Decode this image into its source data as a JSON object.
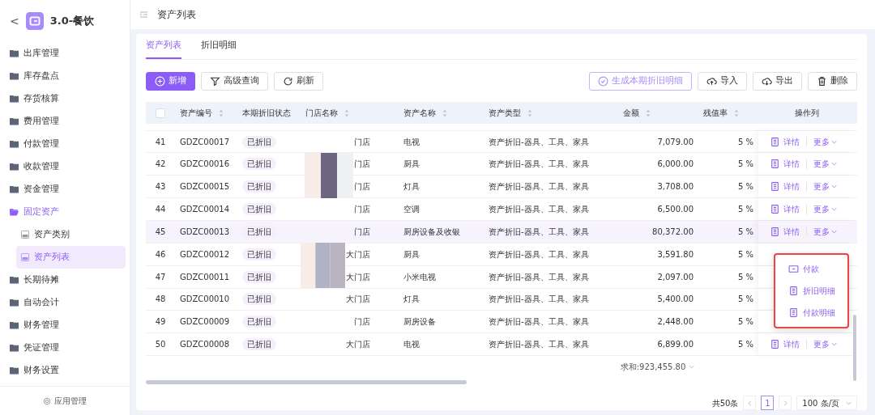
{
  "sidebar": {
    "back": "<",
    "app_title": "3.0-餐饮",
    "items": [
      {
        "label": "出库管理",
        "expanded": false
      },
      {
        "label": "库存盘点",
        "expanded": false
      },
      {
        "label": "存货核算",
        "expanded": false
      },
      {
        "label": "费用管理",
        "expanded": false
      },
      {
        "label": "付款管理",
        "expanded": false
      },
      {
        "label": "收款管理",
        "expanded": false
      },
      {
        "label": "资金管理",
        "expanded": false
      },
      {
        "label": "固定资产",
        "expanded": true,
        "children": [
          {
            "label": "资产类别",
            "selected": false
          },
          {
            "label": "资产列表",
            "selected": true
          }
        ]
      },
      {
        "label": "长期待摊",
        "expanded": false
      },
      {
        "label": "自动会计",
        "expanded": false
      },
      {
        "label": "财务管理",
        "expanded": false
      },
      {
        "label": "凭证管理",
        "expanded": false
      },
      {
        "label": "财务设置",
        "expanded": false
      }
    ],
    "footer": "应用管理"
  },
  "header": {
    "title": "资产列表"
  },
  "tabs": [
    {
      "label": "资产列表",
      "selected": true
    },
    {
      "label": "折旧明细",
      "selected": false
    }
  ],
  "toolbar_left": [
    {
      "label": "新增",
      "kind": "primary"
    },
    {
      "label": "高级查询",
      "kind": "default"
    },
    {
      "label": "刷新",
      "kind": "default"
    }
  ],
  "toolbar_right": [
    {
      "label": "生成本期折旧明细",
      "kind": "outline"
    },
    {
      "label": "导入",
      "kind": "default"
    },
    {
      "label": "导出",
      "kind": "default"
    },
    {
      "label": "删除",
      "kind": "default"
    }
  ],
  "table": {
    "select_all_checked": false,
    "columns": [
      "资产编号",
      "本期折旧状态",
      "门店名称",
      "资产名称",
      "资产类型",
      "金额",
      "残值率",
      "操作列"
    ],
    "rows": [
      {
        "index": "41",
        "code": "GDZC00017",
        "status": "已折旧",
        "store": "门店",
        "name": "电视",
        "type": "资产折旧-器具、工具、家具",
        "amount": "7,079.00",
        "rate": "5 %",
        "actions": [
          "详情",
          "更多"
        ],
        "hovered": false
      },
      {
        "index": "42",
        "code": "GDZC00016",
        "status": "已折旧",
        "store": "门店",
        "name": "厨具",
        "type": "资产折旧-器具、工具、家具",
        "amount": "6,000.00",
        "rate": "5 %",
        "actions": [
          "详情",
          "更多"
        ],
        "hovered": false
      },
      {
        "index": "43",
        "code": "GDZC00015",
        "status": "已折旧",
        "store": "门店",
        "name": "灯具",
        "type": "资产折旧-器具、工具、家具",
        "amount": "3,708.00",
        "rate": "5 %",
        "actions": [
          "详情",
          "更多"
        ],
        "hovered": false
      },
      {
        "index": "44",
        "code": "GDZC00014",
        "status": "已折旧",
        "store": "门店",
        "name": "空调",
        "type": "资产折旧-器具、工具、家具",
        "amount": "6,500.00",
        "rate": "5 %",
        "actions": [
          "详情",
          "更多"
        ],
        "hovered": false
      },
      {
        "index": "45",
        "code": "GDZC00013",
        "status": "已折旧",
        "store": "门店",
        "name": "厨房设备及收银",
        "type": "资产折旧-器具、工具、家具",
        "amount": "80,372.00",
        "rate": "5 %",
        "actions": [
          "详情",
          "更多"
        ],
        "hovered": true
      },
      {
        "index": "46",
        "code": "GDZC00012",
        "status": "已折旧",
        "store": "大门店",
        "name": "厨具",
        "type": "资产折旧-器具、工具、家具",
        "amount": "3,591.80",
        "rate": "5 %",
        "hovered": false
      },
      {
        "index": "47",
        "code": "GDZC00011",
        "status": "已折旧",
        "store": "大门店",
        "name": "小米电视",
        "type": "资产折旧-器具、工具、家具",
        "amount": "2,097.00",
        "rate": "5 %",
        "hovered": false
      },
      {
        "index": "48",
        "code": "GDZC00010",
        "status": "已折旧",
        "store": "大门店",
        "name": "灯具",
        "type": "资产折旧-器具、工具、家具",
        "amount": "5,400.00",
        "rate": "5 %",
        "hovered": false
      },
      {
        "index": "49",
        "code": "GDZC00009",
        "status": "已折旧",
        "store": "门店",
        "name": "厨房设备",
        "type": "资产折旧-器具、工具、家具",
        "amount": "2,448.00",
        "rate": "5 %",
        "hovered": false
      },
      {
        "index": "50",
        "code": "GDZC00008",
        "status": "已折旧",
        "store": "大门店",
        "name": "电视",
        "type": "资产折旧-器具、工具、家具",
        "amount": "6,899.00",
        "rate": "5 %",
        "actions": [
          "详情",
          "更多"
        ],
        "hovered": false
      }
    ],
    "sum": "求和:923,455.80"
  },
  "dropdown": [
    {
      "label": "付款"
    },
    {
      "label": "折旧明细"
    },
    {
      "label": "付款明细"
    }
  ],
  "pagination": {
    "total": "共50条",
    "pages": [
      {
        "label": "1",
        "selected": true
      }
    ],
    "page_size": "100 条/页"
  }
}
